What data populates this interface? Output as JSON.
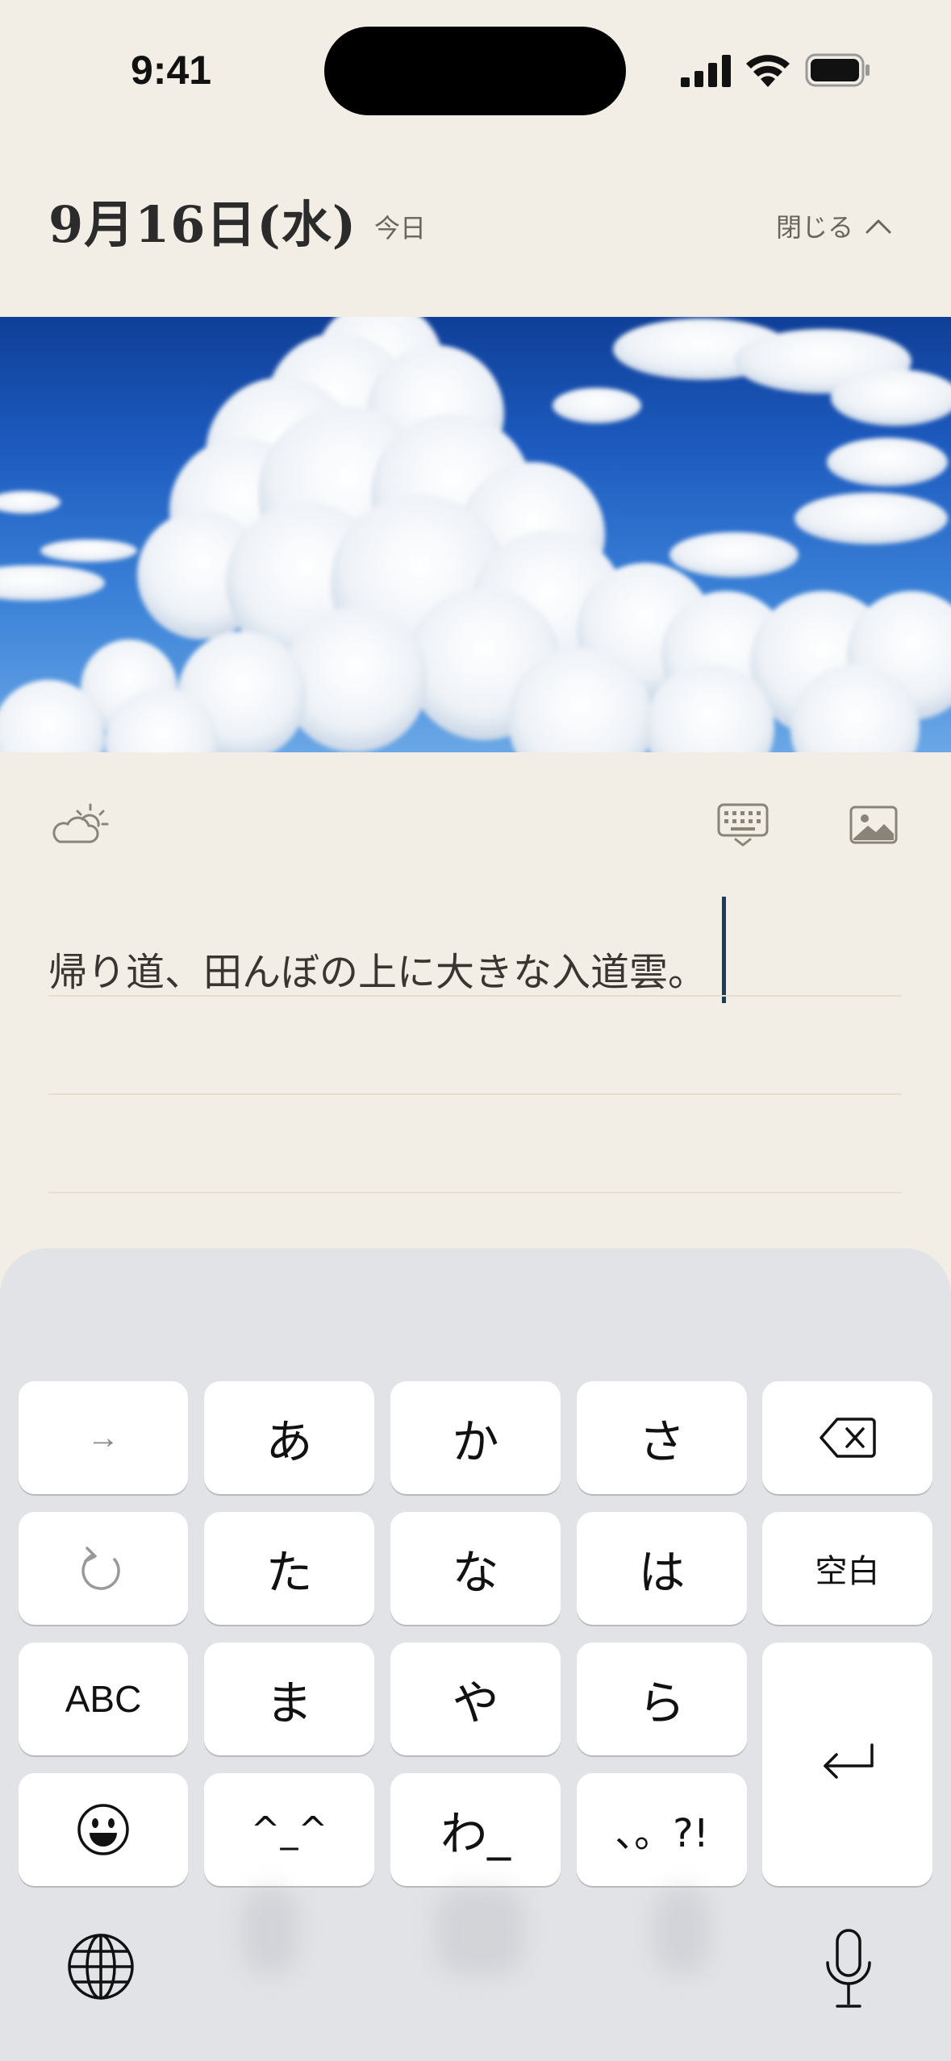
{
  "status_bar": {
    "time": "9:41",
    "icons": [
      "cellular-signal-icon",
      "wifi-icon",
      "battery-icon"
    ]
  },
  "header": {
    "date": "9月16日(水)",
    "today_label": "今日",
    "close_label": "閉じる",
    "close_icon": "chevron-up-icon"
  },
  "photo": {
    "subject": "cumulonimbus-cloud-photo"
  },
  "toolbar": {
    "weather_icon": "partly-cloudy-icon",
    "keyboard_icon": "keyboard-dismiss-icon",
    "image_icon": "image-icon"
  },
  "entry": {
    "lines": [
      "帰り道、田んぼの上に大きな入道雲。",
      "",
      ""
    ]
  },
  "keyboard": {
    "row1": [
      "→",
      "あ",
      "か",
      "さ",
      "delete-icon"
    ],
    "row2": [
      "undo-icon",
      "た",
      "な",
      "は",
      "空白"
    ],
    "row3": [
      "ABC",
      "ま",
      "や",
      "ら",
      "return-icon"
    ],
    "row4": [
      "emoji-icon",
      "^_^",
      "わ_",
      "、。?!"
    ],
    "bottom": [
      "globe-icon",
      "microphone-icon"
    ]
  },
  "colors": {
    "background": "#f2eee6",
    "keyboard_bg": "#e2e3e7",
    "key_bg": "#ffffff",
    "caret": "#1f3b5a",
    "muted_text": "#6a655c"
  }
}
